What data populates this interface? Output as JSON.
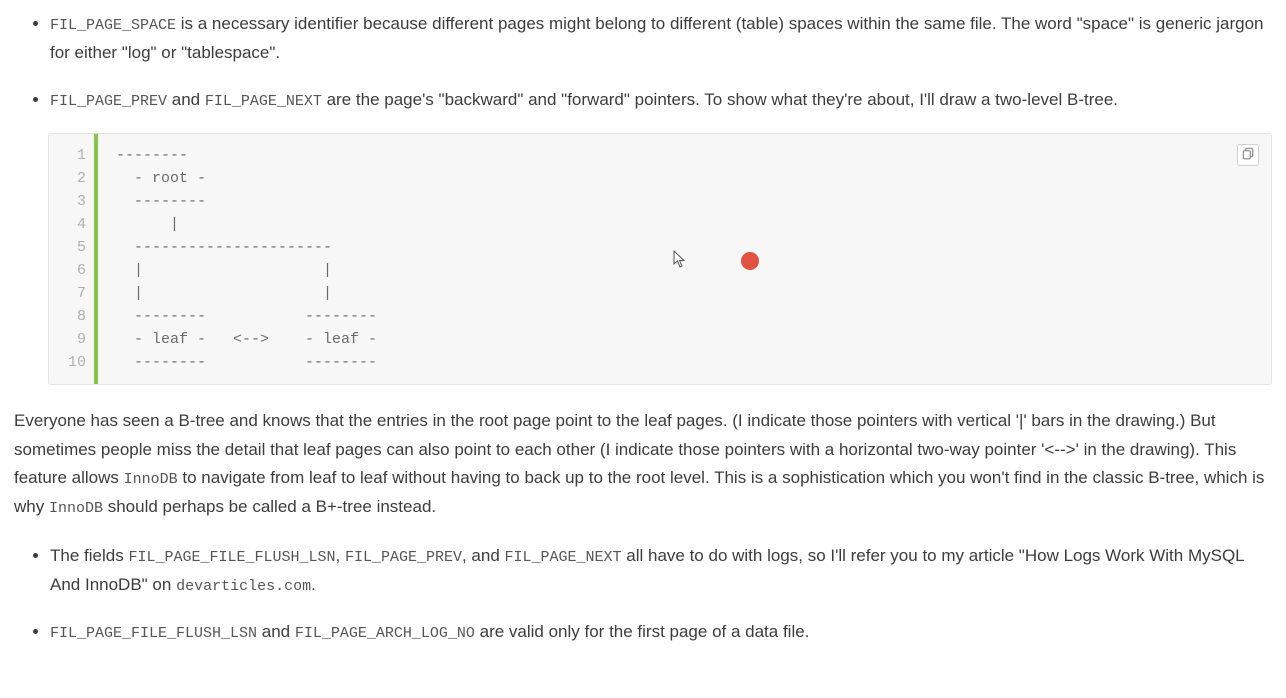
{
  "bullets_top": [
    {
      "code": "FIL_PAGE_SPACE",
      "text": " is a necessary identifier because different pages might belong to different (table) spaces within the same file. The word \"space\" is generic jargon for either \"log\" or \"tablespace\"."
    },
    {
      "code1": "FIL_PAGE_PREV",
      "mid": " and ",
      "code2": "FIL_PAGE_NEXT",
      "text": " are the page's \"backward\" and \"forward\" pointers. To show what they're about, I'll draw a two-level B-tree."
    }
  ],
  "codeblock": {
    "line_numbers": [
      "1",
      "2",
      "3",
      "4",
      "5",
      "6",
      "7",
      "8",
      "9",
      "10"
    ],
    "lines": [
      "--------",
      "  - root -",
      "  --------",
      "      |",
      "  ----------------------",
      "  |                    |",
      "  |                    |",
      "  --------           --------",
      "  - leaf -   <-->    - leaf -",
      "  --------           --------"
    ],
    "copy_label": "copy"
  },
  "paragraph": {
    "part1": "Everyone has seen a B-tree and knows that the entries in the root page point to the leaf pages. (I indicate those pointers with vertical '|' bars in the drawing.) But sometimes people miss the detail that leaf pages can also point to each other (I indicate those pointers with a horizontal two-way pointer '<-->' in the drawing). This feature allows ",
    "code1": "InnoDB",
    "part2": " to navigate from leaf to leaf without having to back up to the root level. This is a sophistication which you won't find in the classic B-tree, which is why ",
    "code2": "InnoDB",
    "part3": " should perhaps be called a B+-tree instead."
  },
  "bullets_bottom": [
    {
      "pre": "The fields ",
      "code1": "FIL_PAGE_FILE_FLUSH_LSN",
      "sep1": ", ",
      "code2": "FIL_PAGE_PREV",
      "sep2": ", and ",
      "code3": "FIL_PAGE_NEXT",
      "post1": " all have to do with logs, so I'll refer you to my article \"How Logs Work With MySQL And InnoDB\" on ",
      "code_site": "devarticles.com",
      "post2": "."
    },
    {
      "code1": "FIL_PAGE_FILE_FLUSH_LSN",
      "mid": " and ",
      "code2": "FIL_PAGE_ARCH_LOG_NO",
      "text": " are valid only for the first page of a data file."
    }
  ]
}
